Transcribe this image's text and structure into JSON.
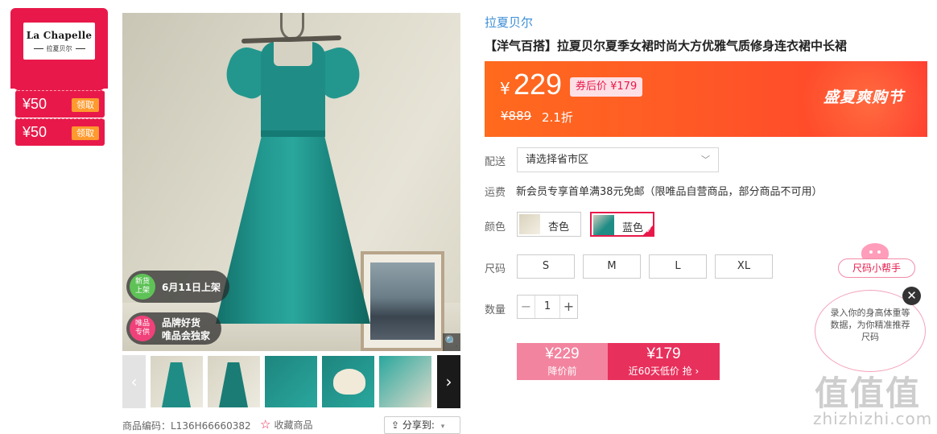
{
  "brand": {
    "logo_text": "La Chapelle",
    "logo_sub": "拉夏贝尔",
    "link": "拉夏贝尔"
  },
  "coupons": [
    {
      "amount": "¥50",
      "action": "领取"
    },
    {
      "amount": "¥50",
      "action": "领取"
    }
  ],
  "gallery": {
    "tags": [
      {
        "badge": "新货\n上架",
        "text": "6月11日上架",
        "badge_color": "#5ec257"
      },
      {
        "badge": "唯品\n专供",
        "text_line1": "品牌好货",
        "text_line2": "唯品会独家",
        "badge_color": "#f0417a"
      }
    ],
    "prev_arrow": "‹",
    "next_arrow": "›",
    "zoom_icon": "🔍"
  },
  "meta": {
    "product_code": "商品编码：L136H66660382",
    "favorite_label": "收藏商品",
    "share_label": "分享到:"
  },
  "product": {
    "title": "【洋气百搭】拉夏贝尔夏季女裙时尚大方优雅气质修身连衣裙中长裙"
  },
  "price": {
    "currency": "¥",
    "current": "229",
    "coupon_price": "券后价 ¥179",
    "original": "¥889",
    "discount": "2.1折",
    "promo": "盛夏爽购节"
  },
  "delivery": {
    "label": "配送",
    "placeholder": "请选择省市区"
  },
  "shipping": {
    "label": "运费",
    "text": "新会员专享首单满38元免邮（限唯品自营商品，部分商品不可用）"
  },
  "colors": {
    "label": "颜色",
    "options": [
      {
        "name": "杏色",
        "selected": false
      },
      {
        "name": "蓝色",
        "selected": true
      }
    ]
  },
  "sizes": {
    "label": "尺码",
    "options": [
      "S",
      "M",
      "L",
      "XL"
    ]
  },
  "quantity": {
    "label": "数量",
    "value": "1",
    "minus": "−",
    "plus": "+"
  },
  "buy": {
    "before_price": "¥229",
    "before_label": "降价前",
    "after_price": "¥179",
    "after_label": "近60天低价 抢 ›"
  },
  "size_helper": {
    "button": "尺码小帮手",
    "bubble": "录入你的身高体重等数据，为你精准推荐尺码",
    "close": "✕"
  },
  "watermark": {
    "main": "值值值",
    "sub": "zhizhizhi.com"
  },
  "colors_theme": {
    "accent": "#e8194a",
    "price_gradient_start": "#ff6a1d",
    "price_gradient_end": "#ff3f2f",
    "link": "#3c8ed6"
  }
}
